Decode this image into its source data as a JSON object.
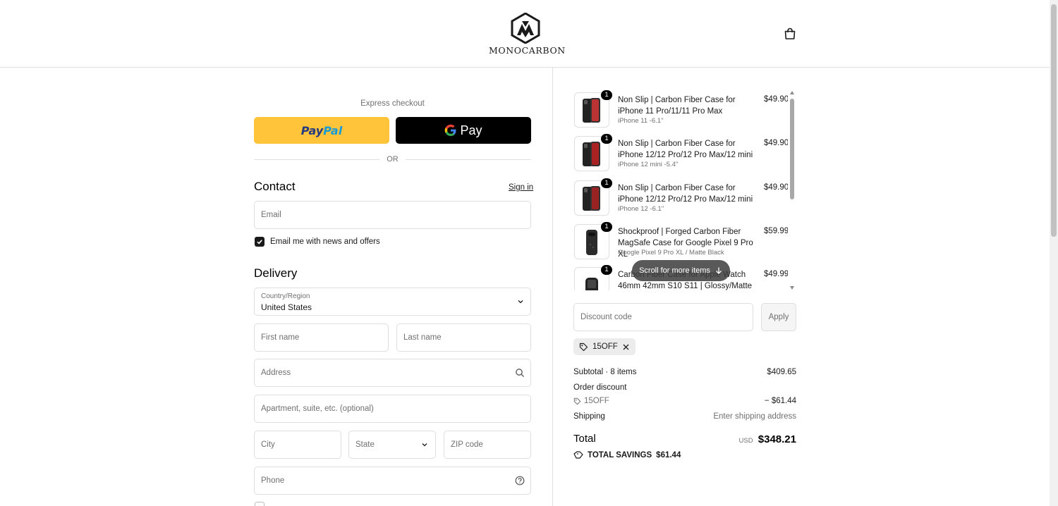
{
  "brand": {
    "name": "MONOCARBON"
  },
  "express": {
    "title": "Express checkout",
    "paypal_label_1": "Pay",
    "paypal_label_2": "Pal",
    "gpay_label": "Pay",
    "or_label": "OR"
  },
  "contact": {
    "title": "Contact",
    "signin_label": "Sign in",
    "email_placeholder": "Email",
    "news_label": "Email me with news and offers",
    "news_checked": true
  },
  "delivery": {
    "title": "Delivery",
    "country_label": "Country/Region",
    "country_value": "United States",
    "first_name_placeholder": "First name",
    "last_name_placeholder": "Last name",
    "address_placeholder": "Address",
    "apartment_placeholder": "Apartment, suite, etc. (optional)",
    "city_placeholder": "City",
    "state_placeholder": "State",
    "zip_placeholder": "ZIP code",
    "phone_placeholder": "Phone"
  },
  "cart": {
    "items": [
      {
        "qty": "1",
        "name": "Non Slip | Carbon Fiber Case for iPhone 11 Pro/11/11 Pro Max",
        "variant": "iPhone 11 -6.1''",
        "price": "$49.90"
      },
      {
        "qty": "1",
        "name": "Non Slip | Carbon Fiber Case for iPhone 12/12 Pro/12 Pro Max/12 mini",
        "variant": "iPhone 12 mini -5.4''",
        "price": "$49.90"
      },
      {
        "qty": "1",
        "name": "Non Slip | Carbon Fiber Case for iPhone 12/12 Pro/12 Pro Max/12 mini",
        "variant": "iPhone 12 -6.1''",
        "price": "$49.90"
      },
      {
        "qty": "1",
        "name": "Shockproof | Forged Carbon Fiber MagSafe Case for Google Pixel 9 Pro XL",
        "variant": "Google Pixel 9 Pro XL / Matte Black",
        "price": "$59.99"
      },
      {
        "qty": "1",
        "name": "Carbon Fiber Case for Apple Watch 46mm 42mm S10 S11 | Glossy/Matte",
        "variant": "",
        "price": "$49.99"
      }
    ],
    "scroll_hint": "Scroll for more items",
    "discount_placeholder": "Discount code",
    "apply_label": "Apply",
    "applied_code": "15OFF"
  },
  "summary": {
    "subtotal_label": "Subtotal · 8 items",
    "subtotal_value": "$409.65",
    "order_discount_label": "Order discount",
    "discount_code": "15OFF",
    "discount_value": "− $61.44",
    "shipping_label": "Shipping",
    "shipping_value": "Enter shipping address",
    "total_label": "Total",
    "currency": "USD",
    "total_value": "$348.21",
    "savings_label": "TOTAL SAVINGS",
    "savings_value": "$61.44"
  }
}
